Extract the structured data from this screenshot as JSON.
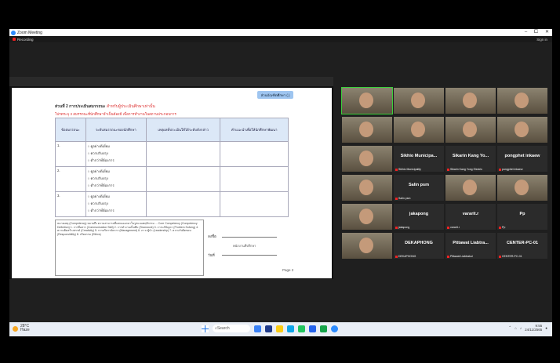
{
  "window": {
    "title": "Zoom Meeting",
    "controls": [
      "–",
      "⧠",
      "✕"
    ]
  },
  "recording": {
    "label": "Recording",
    "signin": "Sign in"
  },
  "doc": {
    "badge": "ส่วนบัณฑิตศึกษา (.)",
    "heading_main": "ส่วนที่ 2 การประเมินสมรรถนะ",
    "heading_note": "สำหรับผู้ประเมินศึกษาเท่านั้น",
    "subheading": "โปรดระบุ 3 สมรรถนะที่นักศึกษาจำเป็นต้องมี เพื่อการทำงานในสถานประกอบการ",
    "columns": [
      "ข้อสมรรถนะ",
      "ระดับสมรรถนะของนักศึกษา",
      "เหตุผลที่ประเมินให้ได้ระดับดังกล่าว",
      "คำแนะนำเพื่อให้นักศึกษาพัฒนา"
    ],
    "rows": [
      {
        "num": "1.",
        "options": [
          "ดูอย่างดีเยี่ยม",
          "ควรปรับปรุง",
          "ต่ำกว่าที่ต้องการ"
        ]
      },
      {
        "num": "2.",
        "options": [
          "ดูอย่างดีเยี่ยม",
          "ควรปรับปรุง",
          "ต่ำกว่าที่ต้องการ"
        ]
      },
      {
        "num": "3.",
        "options": [
          "ดูอย่างดีเยี่ยม",
          "ควรปรับปรุง",
          "ต่ำกว่าที่ต้องการ"
        ]
      }
    ],
    "notes": "หมายเหตุ (Competency) หมายถึง ความสามารถที่แสดงออกมาในรูปแบบพฤติกรรม ... Core Competency (Competency Definition) 1. การสื่อสาร (Communication Skill) 2. การทำงานเป็นทีม (Teamwork) 3. การแก้ปัญหา (Problem Solving) 4. ความคิดสร้างสรรค์ (Creativity) 5. การบริหารจัดการ (Management) 6. ภาวะผู้นำ (Leadership) 7. ความรับผิดชอบ (Responsibility) 8. จริยธรรม (Ethics)",
    "sign_label": "ลงชื่อ",
    "sign_caption": "พนักงานที่ปรึกษา",
    "date_label": "วันที่",
    "page": "Page 2"
  },
  "participants": [
    {
      "name": "",
      "video": true,
      "speaker": true
    },
    {
      "name": "",
      "video": true
    },
    {
      "name": "",
      "video": true
    },
    {
      "name": "",
      "video": true
    },
    {
      "name": "",
      "video": true
    },
    {
      "name": "",
      "video": true
    },
    {
      "name": "",
      "video": true
    },
    {
      "name": "",
      "video": true
    },
    {
      "name": "",
      "video": true
    },
    {
      "name": "Sikhio Municipa...",
      "video": false,
      "label": "Sikhio Municipality"
    },
    {
      "name": "Sikarin Kang Yo...",
      "video": false,
      "label": "Sikarin Kang Yong Electric"
    },
    {
      "name": "pongphet inkaew",
      "video": false,
      "label": "pongphet inkaew"
    },
    {
      "name": "",
      "video": true
    },
    {
      "name": "Salin psm",
      "video": false,
      "label": "Salin psm"
    },
    {
      "name": "",
      "video": true
    },
    {
      "name": "",
      "video": true
    },
    {
      "name": "",
      "video": true
    },
    {
      "name": "jakapong",
      "video": false,
      "label": "jakapong"
    },
    {
      "name": "vararit.r",
      "video": false,
      "label": "vararit.r"
    },
    {
      "name": "Pp",
      "video": false,
      "label": "Pp"
    },
    {
      "name": "",
      "video": true
    },
    {
      "name": "DEKAPHONG",
      "video": false,
      "label": "DEKAPHONG"
    },
    {
      "name": "Pittawat Liabtra...",
      "video": false,
      "label": "Pittawat Liabtrakul"
    },
    {
      "name": "CENTER-PC-01",
      "video": false,
      "label": "CENTER-PC-01"
    }
  ],
  "taskbar": {
    "temp": "28°C",
    "weather": "Haze",
    "search": "Search",
    "time": "9:55",
    "date": "24/11/2565"
  }
}
